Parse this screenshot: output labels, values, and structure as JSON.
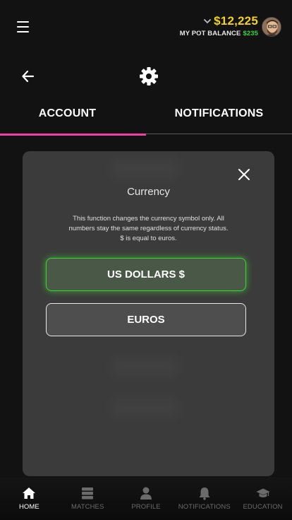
{
  "header": {
    "balance": "$12,225",
    "pot_label": "MY POT BALANCE",
    "pot_value": "$235"
  },
  "tabs": [
    {
      "label": "ACCOUNT",
      "active": true
    },
    {
      "label": "NOTIFICATIONS",
      "active": false
    }
  ],
  "modal": {
    "title": "Currency",
    "description": "This function changes the currency symbol only. All numbers stay the same regardless of currency status. $ is equal to euros.",
    "options": [
      {
        "label": "US DOLLARS $",
        "selected": true
      },
      {
        "label": "EUROS",
        "selected": false
      }
    ]
  },
  "bottom_nav": [
    {
      "label": "HOME",
      "icon": "home-icon",
      "active": true
    },
    {
      "label": "MATCHES",
      "icon": "matches-icon",
      "active": false
    },
    {
      "label": "PROFILE",
      "icon": "profile-icon",
      "active": false
    },
    {
      "label": "NOTIFICATIONS",
      "icon": "bell-icon",
      "active": false
    },
    {
      "label": "EDUCATION",
      "icon": "graduation-cap-icon",
      "active": false
    }
  ],
  "colors": {
    "accent_pink": "#f23fa3",
    "balance_yellow": "#f2d21a",
    "pot_green": "#36d33a",
    "selected_green": "#3ed334"
  }
}
